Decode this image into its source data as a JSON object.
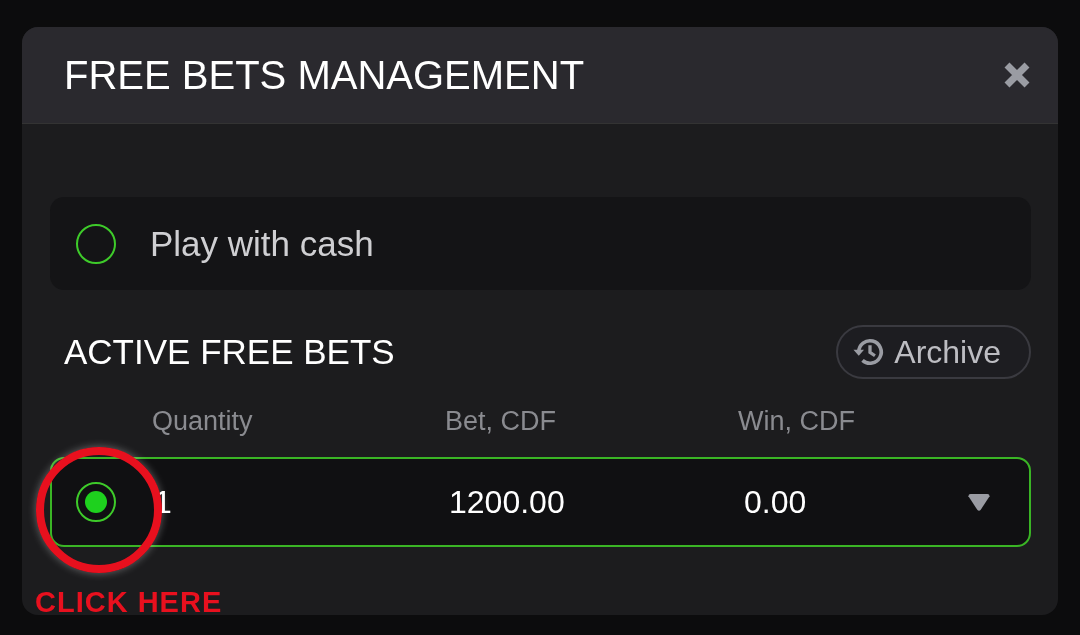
{
  "modal": {
    "title": "FREE BETS MANAGEMENT"
  },
  "cash_option": {
    "label": "Play with cash",
    "selected": false
  },
  "active_free_bets": {
    "title": "ACTIVE FREE BETS",
    "archive_button": "Archive",
    "columns": [
      "Quantity",
      "Bet, CDF",
      "Win, CDF"
    ],
    "rows": [
      {
        "selected": true,
        "quantity": "1",
        "bet": "1200.00",
        "win": "0.00"
      }
    ]
  },
  "annotation": {
    "text": "CLICK HERE"
  }
}
